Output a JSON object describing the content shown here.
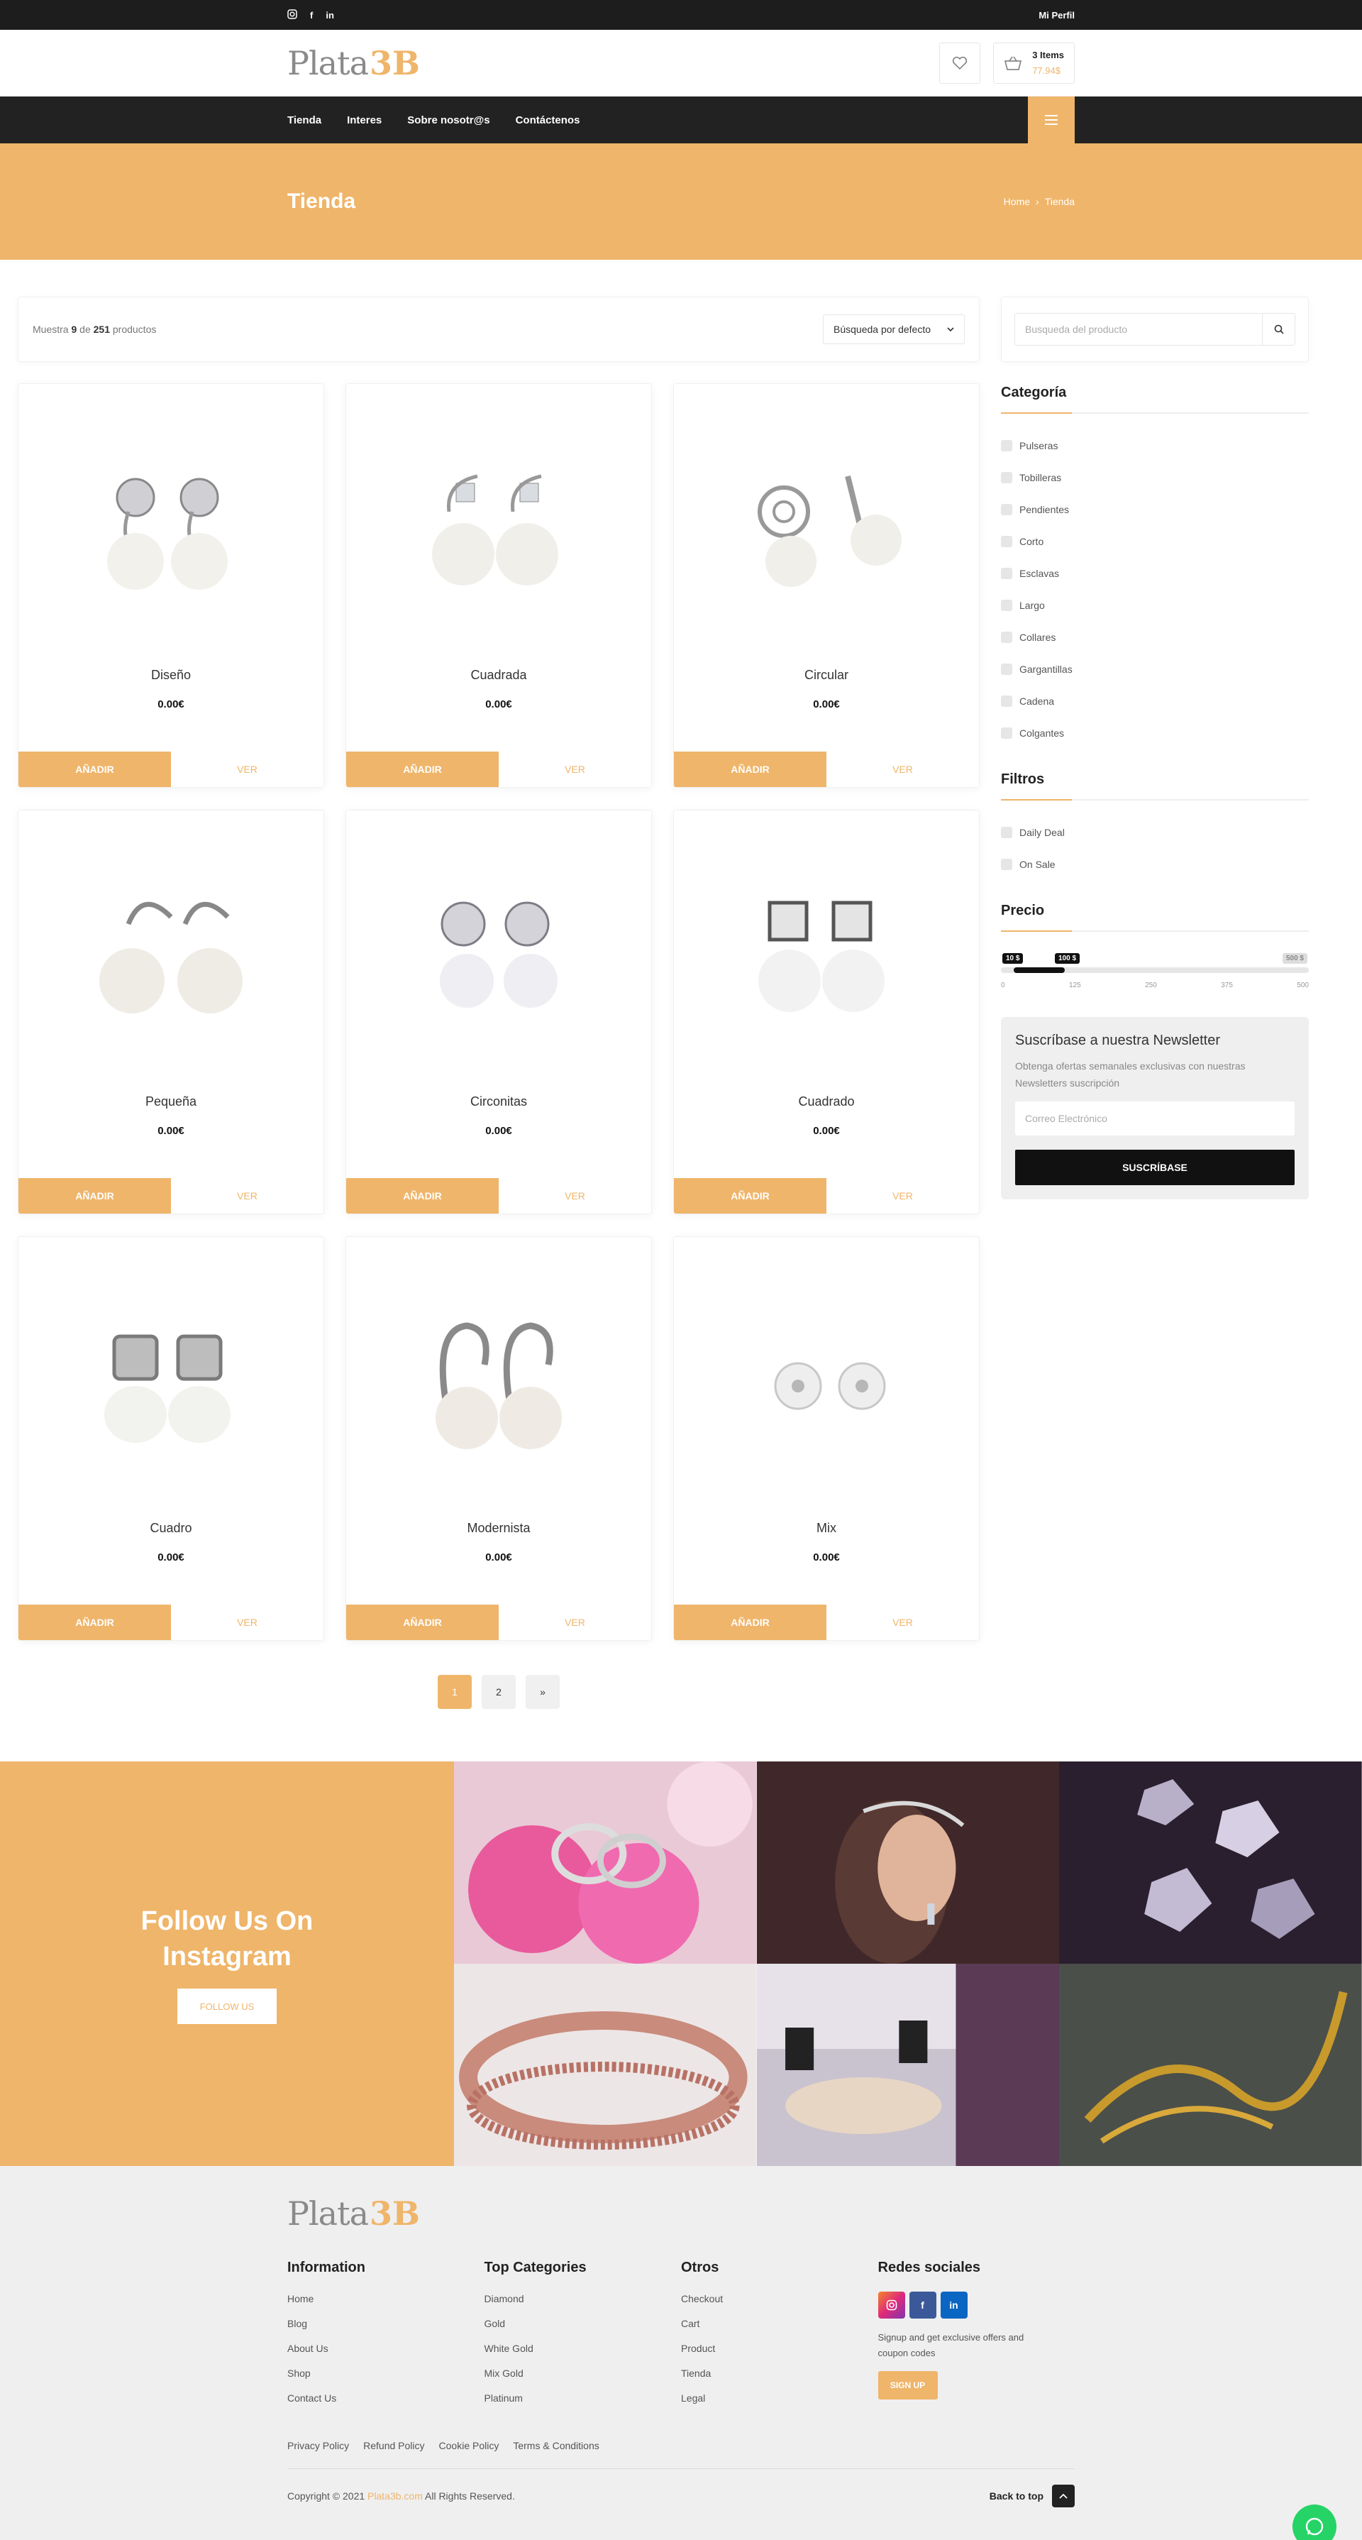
{
  "topbar": {
    "social": [
      "instagram-icon",
      "facebook-icon",
      "linkedin-icon"
    ],
    "profile": "Mi Perfil"
  },
  "header": {
    "logo_text": "Plata",
    "logo_mark": "3B",
    "cart_items": "3 Items",
    "cart_total": "77.94$"
  },
  "nav": {
    "links": [
      "Tienda",
      "Interes",
      "Sobre nosotr@s",
      "Contáctenos"
    ]
  },
  "title_band": {
    "title": "Tienda",
    "crumb_home": "Home",
    "crumb_sep": "›",
    "crumb_current": "Tienda"
  },
  "toolbar": {
    "results_prefix": "Muestra",
    "results_count": "9",
    "results_mid": "de",
    "results_total": "251",
    "results_suffix": "productos",
    "sort_label": "Búsqueda por defecto"
  },
  "products": [
    {
      "name": "Diseño",
      "price": "0.00€"
    },
    {
      "name": "Cuadrada",
      "price": "0.00€"
    },
    {
      "name": "Circular",
      "price": "0.00€"
    },
    {
      "name": "Pequeña",
      "price": "0.00€"
    },
    {
      "name": "Circonitas",
      "price": "0.00€"
    },
    {
      "name": "Cuadrado",
      "price": "0.00€"
    },
    {
      "name": "Cuadro",
      "price": "0.00€"
    },
    {
      "name": "Modernista",
      "price": "0.00€"
    },
    {
      "name": "Mix",
      "price": "0.00€"
    }
  ],
  "card_buttons": {
    "add": "AÑADIR",
    "view": "VER"
  },
  "pagination": [
    "1",
    "2",
    "»"
  ],
  "sidebar": {
    "search_placeholder": "Busqueda del producto",
    "category_title": "Categoría",
    "categories": [
      "Pulseras",
      "Tobilleras",
      "Pendientes",
      "Corto",
      "Esclavas",
      "Largo",
      "Collares",
      "Gargantillas",
      "Cadena",
      "Colgantes"
    ],
    "filters_title": "Filtros",
    "filters": [
      "Daily Deal",
      "On Sale"
    ],
    "price_title": "Precio",
    "price_min_tag": "10 $",
    "price_max_tag": "100 $",
    "price_limit_tag": "500 $",
    "price_ticks": [
      "0",
      "125",
      "250",
      "375",
      "500"
    ],
    "price_range": [
      10,
      100
    ],
    "price_scale": [
      0,
      500
    ]
  },
  "newsletter": {
    "title": "Suscríbase a nuestra Newsletter",
    "desc": "Obtenga ofertas semanales exclusivas con nuestras Newsletters suscripción",
    "placeholder": "Correo Electrónico",
    "button": "SUSCRÍBASE"
  },
  "instagram": {
    "title": "Follow Us On Instagram",
    "button": "FOLLOW US"
  },
  "footer": {
    "info_title": "Information",
    "info_links": [
      "Home",
      "Blog",
      "About Us",
      "Shop",
      "Contact Us"
    ],
    "cat_title": "Top Categories",
    "cat_links": [
      "Diamond",
      "Gold",
      "White Gold",
      "Mix Gold",
      "Platinum"
    ],
    "otros_title": "Otros",
    "otros_links": [
      "Checkout",
      "Cart",
      "Product",
      "Tienda",
      "Legal"
    ],
    "social_title": "Redes sociales",
    "social_text": "Signup and get exclusive offers and coupon codes",
    "signup": "SIGN UP",
    "policies": [
      "Privacy Policy",
      "Refund Policy",
      "Cookie Policy",
      "Terms & Conditions"
    ],
    "copyright_prefix": "Copyright © 2021",
    "copyright_brand": "Plata3b.com",
    "copyright_suffix": "All Rights Reserved.",
    "back_to_top": "Back to top"
  },
  "colors": {
    "accent": "#efb56a",
    "dark": "#1d1d1d",
    "light_bg": "#efeff0"
  }
}
